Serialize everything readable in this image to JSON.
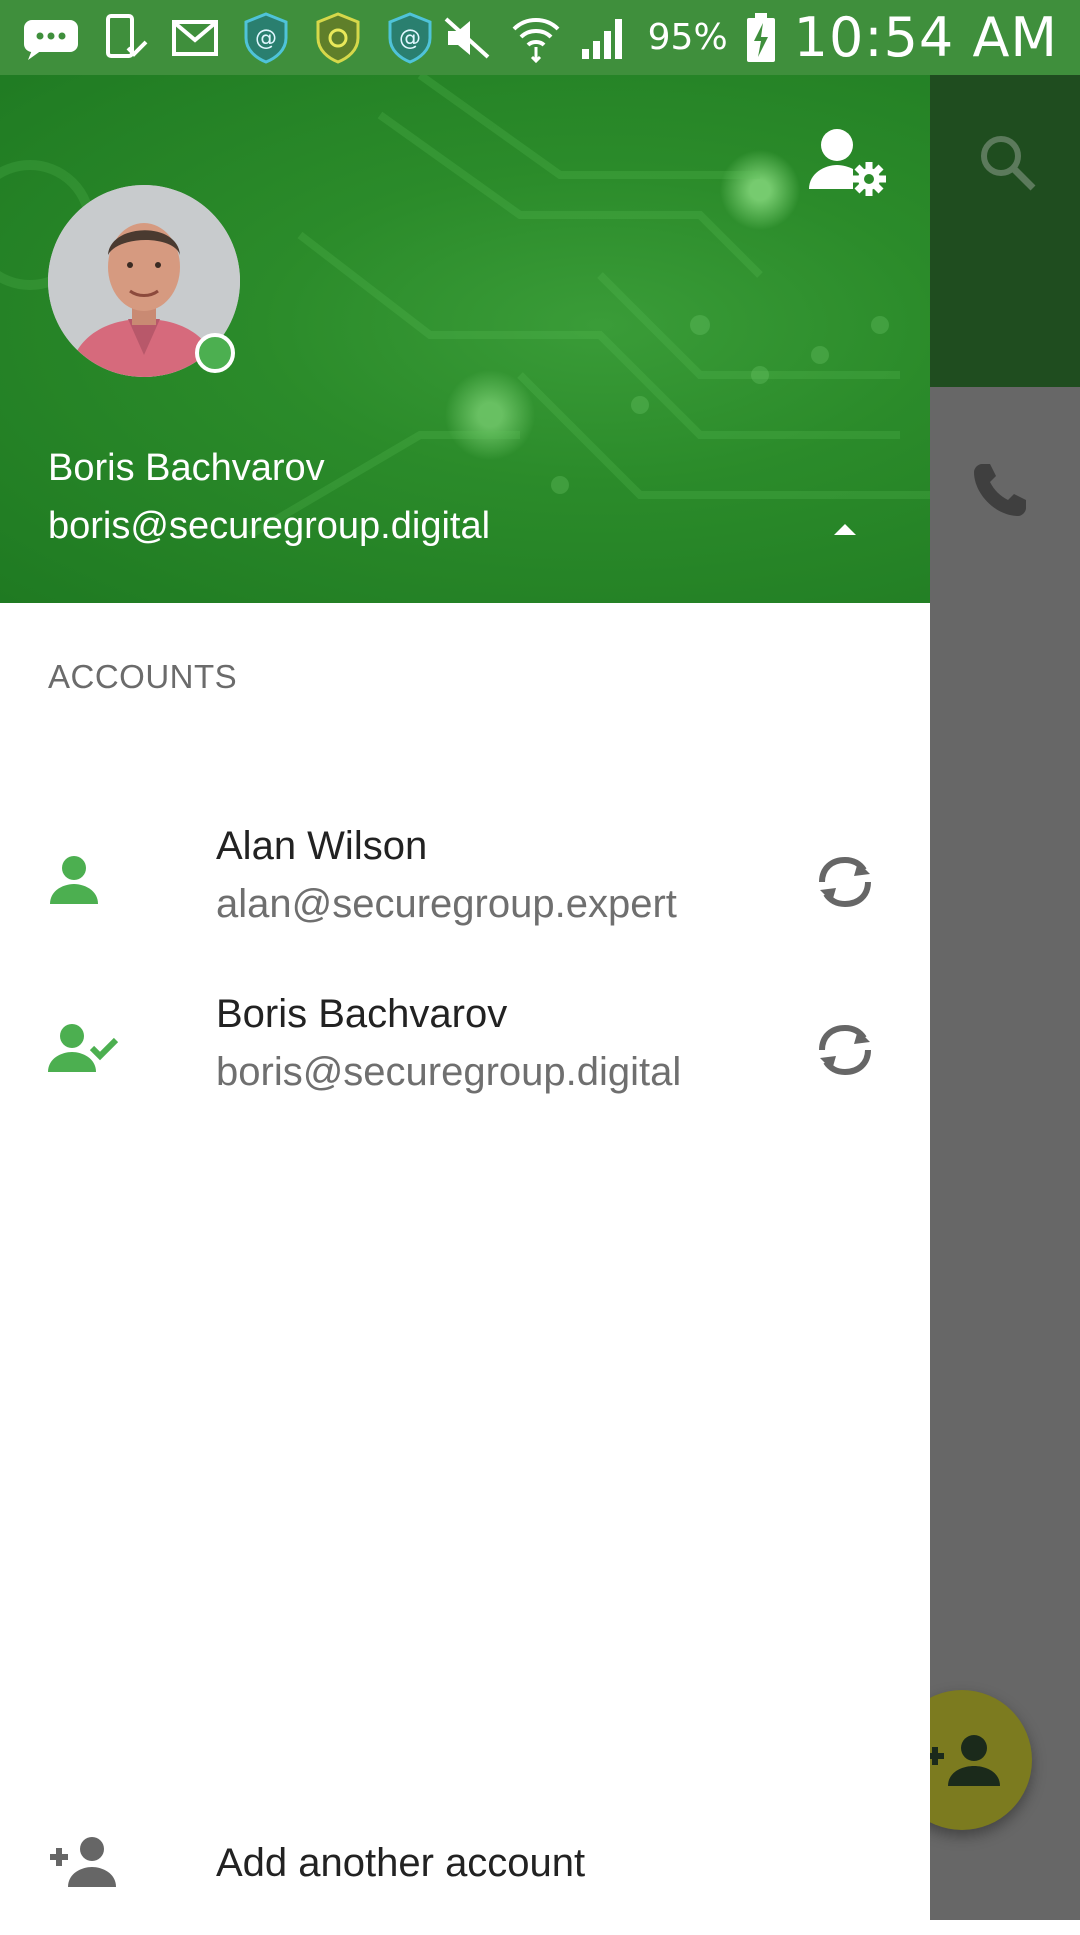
{
  "status_bar": {
    "battery": "95%",
    "time": "10:54 AM"
  },
  "header": {
    "user_name": "Boris Bachvarov",
    "user_email": "boris@securegroup.digital",
    "accent": "#2e8b2e"
  },
  "accounts": {
    "title": "ACCOUNTS",
    "items": [
      {
        "name": "Alan Wilson",
        "email": "alan@securegroup.expert",
        "icon": "person-icon"
      },
      {
        "name": "Boris Bachvarov",
        "email": "boris@securegroup.digital",
        "icon": "person-check-icon"
      }
    ]
  },
  "add_account": {
    "label": "Add another account"
  },
  "colors": {
    "green": "#4caf50",
    "fab": "#7c7b1f",
    "scrim": "#676767"
  }
}
